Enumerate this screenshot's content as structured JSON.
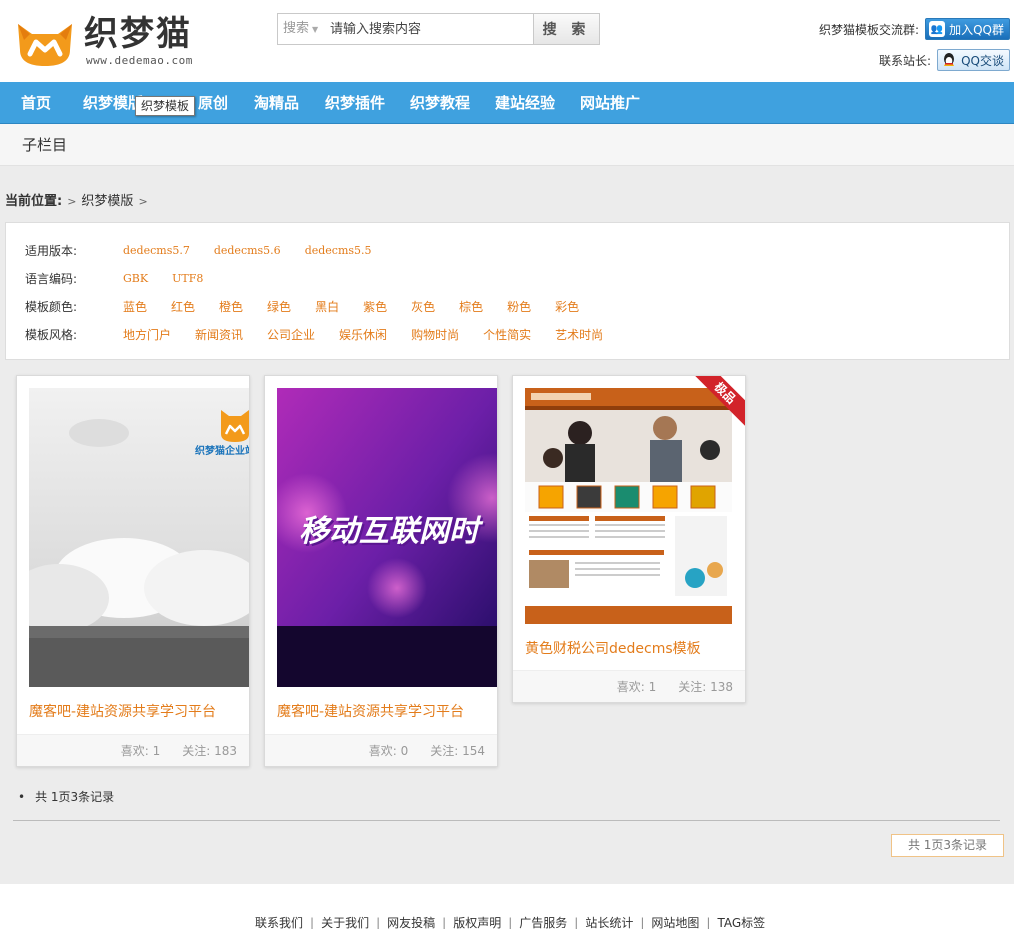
{
  "header": {
    "logo_text": "织梦猫",
    "logo_url": "www.dedemao.com",
    "search": {
      "type_label": "搜索",
      "placeholder": "请输入搜索内容",
      "button_label": "搜 索"
    },
    "qq_group_label": "织梦猫模板交流群:",
    "qq_group_button": "加入QQ群",
    "contact_label": "联系站长:",
    "contact_button": "QQ交谈"
  },
  "nav": {
    "items": [
      {
        "label": "首页"
      },
      {
        "label": "织梦模版"
      },
      {
        "label": "原创"
      },
      {
        "label": "淘精品"
      },
      {
        "label": "织梦插件"
      },
      {
        "label": "织梦教程"
      },
      {
        "label": "建站经验"
      },
      {
        "label": "网站推广"
      }
    ],
    "tooltip": "织梦模板"
  },
  "subbar": {
    "title": "子栏目"
  },
  "breadcrumb": {
    "label": "当前位置:",
    "items": [
      "织梦模版"
    ]
  },
  "filters": [
    {
      "label": "适用版本:",
      "options": [
        "dedecms5.7",
        "dedecms5.6",
        "dedecms5.5"
      ]
    },
    {
      "label": "语言编码:",
      "options": [
        "GBK",
        "UTF8"
      ]
    },
    {
      "label": "模板颜色:",
      "options": [
        "蓝色",
        "红色",
        "橙色",
        "绿色",
        "黑白",
        "紫色",
        "灰色",
        "棕色",
        "粉色",
        "彩色"
      ]
    },
    {
      "label": "模板风格:",
      "options": [
        "地方门户",
        "新闻资讯",
        "公司企业",
        "娱乐休闲",
        "购物时尚",
        "个性简实",
        "艺术时尚"
      ]
    }
  ],
  "cards": [
    {
      "title": "魔客吧-建站资源共享学习平台",
      "likes_label": "喜欢:",
      "likes": "1",
      "follows_label": "关注:",
      "follows": "183",
      "thumb_text": "织梦猫企业站"
    },
    {
      "title": "魔客吧-建站资源共享学习平台",
      "likes_label": "喜欢:",
      "likes": "0",
      "follows_label": "关注:",
      "follows": "154",
      "thumb_text": "移动互联网时"
    },
    {
      "title": "黄色财税公司dedecms模板",
      "likes_label": "喜欢:",
      "likes": "1",
      "follows_label": "关注:",
      "follows": "138",
      "badge": "极品"
    }
  ],
  "pagination": {
    "summary": "共 1页3条记录",
    "box": "共 1页3条记录"
  },
  "footer": {
    "links": [
      "联系我们",
      "关于我们",
      "网友投稿",
      "版权声明",
      "广告服务",
      "站长统计",
      "网站地图",
      "TAG标签"
    ]
  },
  "colors": {
    "nav_bg": "#3fa1df",
    "accent_orange": "#e37c1b",
    "badge_red": "#d2232a"
  }
}
